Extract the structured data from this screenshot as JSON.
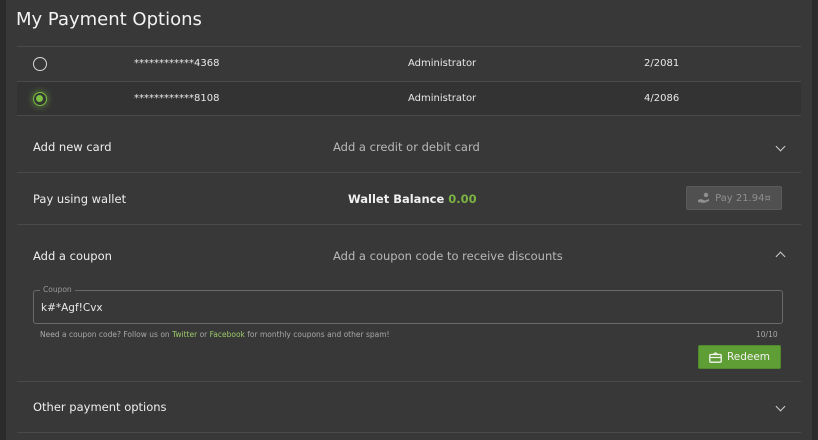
{
  "page": {
    "title": "My Payment Options"
  },
  "cards": [
    {
      "number": "************4368",
      "role": "Administrator",
      "expiry": "2/2081",
      "selected": false
    },
    {
      "number": "************8108",
      "role": "Administrator",
      "expiry": "4/2086",
      "selected": true
    }
  ],
  "add_card": {
    "label": "Add new card",
    "description": "Add a credit or debit card"
  },
  "wallet": {
    "label": "Pay using wallet",
    "balance_label": "Wallet Balance",
    "balance_value": "0.00",
    "pay_button": "Pay 21.94¤"
  },
  "coupon": {
    "label": "Add a coupon",
    "description": "Add a coupon code to receive discounts",
    "field_legend": "Coupon",
    "field_value": "k#*Agf!Cvx",
    "hint_before": "Need a coupon code? Follow us on ",
    "hint_twitter": "Twitter",
    "hint_or": " or ",
    "hint_facebook": "Facebook",
    "hint_after": " for monthly coupons and other spam!",
    "char_count": "10/10",
    "redeem_button": "Redeem"
  },
  "other": {
    "label": "Other payment options"
  },
  "colors": {
    "accent": "#7cc142",
    "button_green": "#5f9e35",
    "panel": "#383838"
  }
}
